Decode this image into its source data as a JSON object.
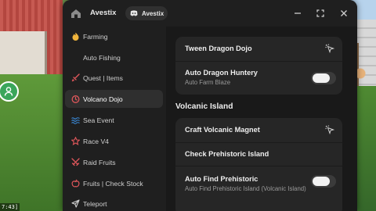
{
  "window": {
    "title": "Avestix",
    "chip_label": "Avestix",
    "accent": "#e9a23b"
  },
  "sidebar": {
    "items": [
      {
        "label": "Farming",
        "icon": "fire-icon",
        "icon_color": "#f0b43c",
        "active": false
      },
      {
        "label": "Auto Fishing",
        "icon": "none",
        "icon_color": "",
        "active": false
      },
      {
        "label": "Quest | Items",
        "icon": "sword-icon",
        "icon_color": "#e0575b",
        "active": false
      },
      {
        "label": "Volcano Dojo",
        "icon": "volcano-icon",
        "icon_color": "#e0575b",
        "active": true
      },
      {
        "label": "Sea Event",
        "icon": "waves-icon",
        "icon_color": "#3c8ee0",
        "active": false
      },
      {
        "label": "Race V4",
        "icon": "star-badge-icon",
        "icon_color": "#e0575b",
        "active": false
      },
      {
        "label": "Raid Fruits",
        "icon": "swords-icon",
        "icon_color": "#e0575b",
        "active": false
      },
      {
        "label": "Fruits | Check Stock",
        "icon": "apple-icon",
        "icon_color": "#e0575b",
        "active": false
      },
      {
        "label": "Teleport",
        "icon": "send-icon",
        "icon_color": "#cfcfcf",
        "active": false
      }
    ]
  },
  "content": {
    "card1": {
      "tween_label": "Tween Dragon Dojo",
      "auto_dragon_title": "Auto Dragon Huntery",
      "auto_dragon_sub": "Auto Farm Blaze",
      "auto_dragon_on": false
    },
    "section_title": "Volcanic Island",
    "card2": {
      "craft_label": "Craft Volcanic Magnet",
      "check_label": "Check Prehistoric Island",
      "auto_find_title": "Auto Find Prehistoric",
      "auto_find_sub": "Auto Find Prehistoric Island (Volcanic Island)",
      "auto_find_on": false
    }
  },
  "hud": {
    "corner_text": "7:43]"
  }
}
